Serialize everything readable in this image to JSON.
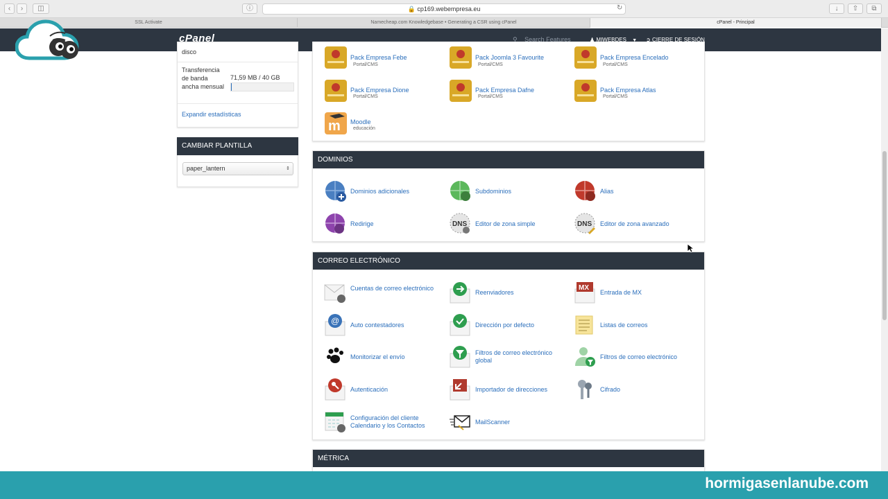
{
  "browser": {
    "url": "cp169.webempresa.eu",
    "tabs": [
      "SSL Activate",
      "Namecheap.com Knowledgebase • Generating a CSR using cPanel",
      "cPanel - Principal"
    ]
  },
  "header": {
    "logo": "cPanel",
    "search_placeholder": "Search Features",
    "user": "MIWEBDES",
    "logout": "CIERRE DE SESIÓN"
  },
  "stats": {
    "truncated_label": "disco",
    "bandwidth_label": "Transferencia de banda ancha mensual",
    "bandwidth_value": "71,59 MB / 40 GB",
    "bandwidth_fraction": 0.0018,
    "expand_link": "Expandir estadísticas"
  },
  "template_panel": {
    "title": "CAMBIAR PLANTILLA",
    "selected": "paper_lantern"
  },
  "apps": {
    "items": [
      {
        "label": "Pack Empresa Febe",
        "sub": "Portal/CMS"
      },
      {
        "label": "Pack Joomla 3 Favourite",
        "sub": "Portal/CMS"
      },
      {
        "label": "Pack Empresa Encelado",
        "sub": "Portal/CMS"
      },
      {
        "label": "Pack Empresa Dione",
        "sub": "Portal/CMS"
      },
      {
        "label": "Pack Empresa Dafne",
        "sub": "Portal/CMS"
      },
      {
        "label": "Pack Empresa Atlas",
        "sub": "Portal/CMS"
      },
      {
        "label": "Moodle",
        "sub": "educación"
      }
    ]
  },
  "domains": {
    "title": "DOMINIOS",
    "items": [
      "Dominios adicionales",
      "Subdominios",
      "Alias",
      "Redirige",
      "Editor de zona simple",
      "Editor de zona avanzado"
    ]
  },
  "email": {
    "title": "CORREO ELECTRÓNICO",
    "items": [
      "Cuentas de correo electrónico",
      "Reenviadores",
      "Entrada de MX",
      "Auto contestadores",
      "Dirección por defecto",
      "Listas de correos",
      "Monitorizar el envío",
      "Filtros de correo electrónico global",
      "Filtros de correo electrónico",
      "Autenticación",
      "Importador de direcciones",
      "Cifrado",
      "Configuración del cliente Calendario y los Contactos",
      "MailScanner"
    ]
  },
  "metrics": {
    "title": "MÉTRICA"
  },
  "banner": {
    "text": "hormigasenlanube.com"
  },
  "colors": {
    "header_bg": "#2d3641",
    "link": "#2a6ebb",
    "banner": "#2aa0ad"
  }
}
